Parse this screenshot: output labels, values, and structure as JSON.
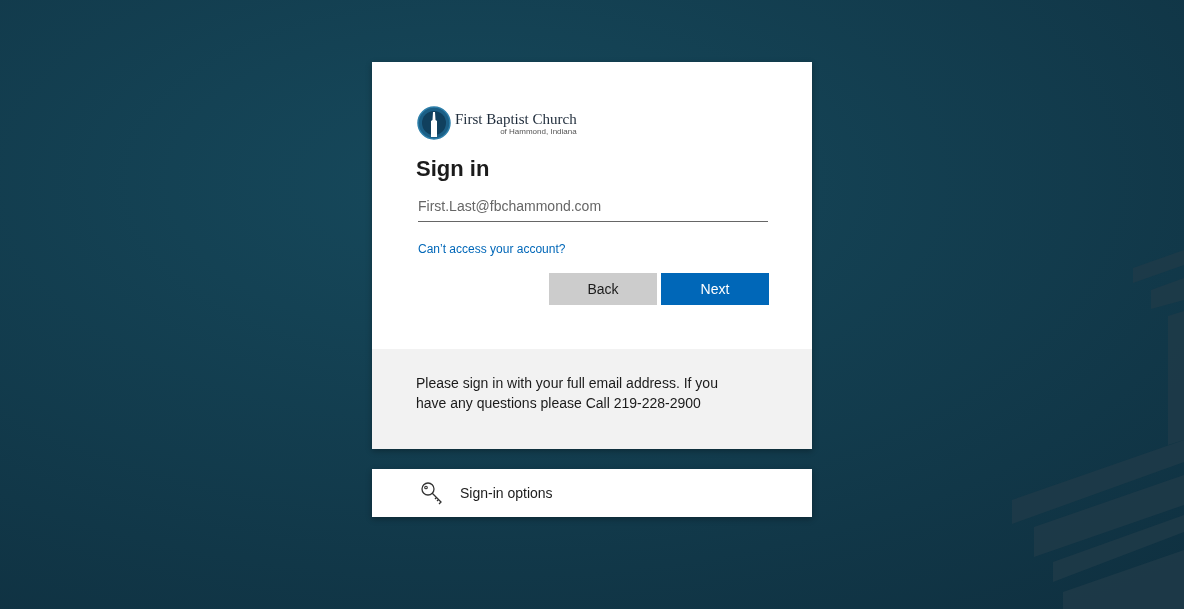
{
  "logo": {
    "name": "First Baptist Church",
    "subtitle": "of Hammond, Indiana"
  },
  "title": "Sign in",
  "email_field": {
    "placeholder": "First.Last@fbchammond.com"
  },
  "help_link": "Can’t access your account?",
  "buttons": [
    {
      "label": "Back",
      "kind": "secondary"
    },
    {
      "label": "Next",
      "kind": "primary"
    }
  ],
  "notice": "Please sign in with your full email address. If you have any questions please Call 219-228-2900",
  "options": {
    "label": "Sign-in options"
  }
}
